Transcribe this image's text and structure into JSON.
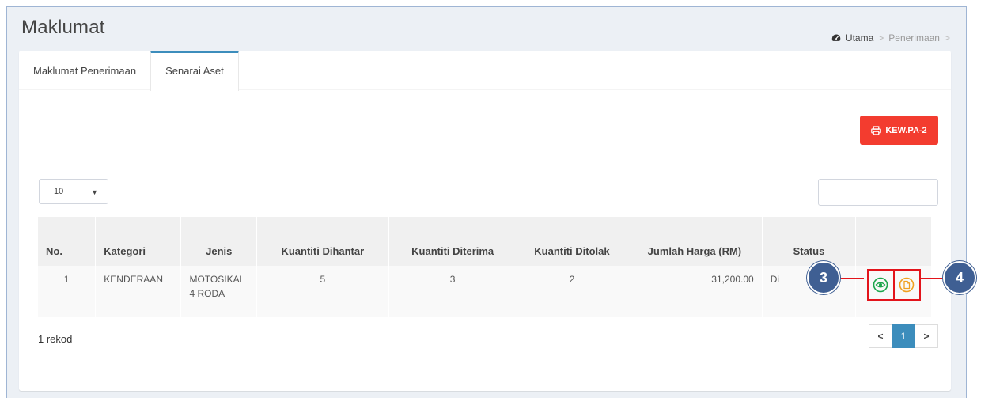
{
  "page": {
    "title": "Maklumat"
  },
  "breadcrumb": {
    "home": "Utama",
    "separator": ">",
    "current": "Penerimaan",
    "trailing_separator": ">"
  },
  "tabs": [
    {
      "label": "Maklumat Penerimaan",
      "active": false
    },
    {
      "label": "Senarai Aset",
      "active": true
    }
  ],
  "print_button": {
    "label": "KEW.PA-2",
    "color": "#f33c2f"
  },
  "length_select": {
    "value": "10"
  },
  "search": {
    "placeholder": ""
  },
  "table": {
    "headers": {
      "no": "No.",
      "kategori": "Kategori",
      "jenis": "Jenis",
      "kuantiti_dihantar": "Kuantiti Dihantar",
      "kuantiti_diterima": "Kuantiti Diterima",
      "kuantiti_ditolak": "Kuantiti Ditolak",
      "jumlah_harga": "Jumlah Harga (RM)",
      "status": "Status"
    },
    "rows": [
      {
        "no": "1",
        "kategori": "KENDERAAN",
        "jenis": "MOTOSIKAL 4 RODA",
        "kuantiti_dihantar": "5",
        "kuantiti_diterima": "3",
        "kuantiti_ditolak": "2",
        "jumlah_harga": "31,200.00",
        "status": "Di"
      }
    ]
  },
  "footer": {
    "record_count": "1 rekod"
  },
  "pagination": {
    "prev": "<",
    "current": "1",
    "next": ">"
  },
  "callouts": {
    "view": "3",
    "document": "4"
  },
  "colors": {
    "accent": "#3c8dbc",
    "danger": "#f33c2f",
    "view_icon": "#1aa54a",
    "doc_icon": "#f0a020",
    "callout": "#3f5f93",
    "highlight": "#e3141b"
  }
}
